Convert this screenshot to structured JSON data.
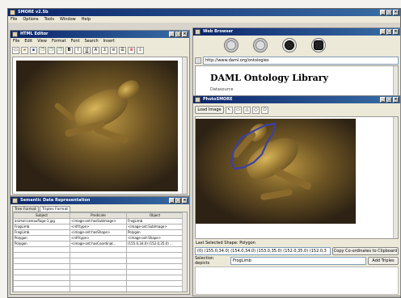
{
  "main_window": {
    "title": "SMORE v2.5b",
    "menu": [
      "File",
      "Options",
      "Tools",
      "Window",
      "Help"
    ]
  },
  "html_editor": {
    "title": "HTML Editor",
    "menu": [
      "File",
      "Edit",
      "View",
      "Format",
      "Font",
      "Search",
      "Insert"
    ],
    "toolbar_icons": [
      "new-icon",
      "open-icon",
      "save-icon",
      "copy-icon",
      "paste-icon",
      "find-icon",
      "bold-icon",
      "italic-icon",
      "underline-icon",
      "link-icon",
      "anchor-icon",
      "align-left-icon",
      "list-icon",
      "stop-icon",
      "download-icon"
    ]
  },
  "semantic_data": {
    "title": "Semantic Data Representation",
    "tabs": [
      "Tree Format",
      "Triples Format"
    ],
    "columns": [
      "Subject",
      "Predicate",
      "Object"
    ],
    "rows": [
      [
        "animal:camouflage-1.jpg",
        "<image-ont:hasSubImage>",
        "FrogLimb"
      ],
      [
        "FrogLimb",
        "<rdf:type>",
        "<image-ont:SubImage>"
      ],
      [
        "FrogLimb",
        "<image-ont:hasShape>",
        "Polygon"
      ],
      [
        "Polygon",
        "<rdf:type>",
        "<image-ont:Shape>"
      ],
      [
        "Polygon",
        "<image-ont:hasCoordinat...",
        "(155.0,34.0) (152.0,35.0) ..."
      ]
    ]
  },
  "web_browser": {
    "title": "Web Browser",
    "url": "http://www.daml.org/ontologies",
    "page_heading": "DAML Ontology Library",
    "page_text": "Datasource"
  },
  "photo_smore": {
    "title": "PhotoSMORE",
    "load_image_label": "Load Image",
    "shape_tools": [
      "pointer-icon",
      "rectangle-icon",
      "triangle-icon",
      "circle-icon",
      "polygon-icon"
    ],
    "last_selected_shape": "Last Selected Shape: Polygon",
    "coordinates": "(0) (155.0,34.0) (154.0,34.0) (153.0,35.0) (152.0,35.0) (152.0,3",
    "copy_button": "Copy Co-ordinates to Clipboard",
    "selection_label": "Selection depicts",
    "selection_value": "FrogLimb",
    "add_triples_button": "Add Triples"
  },
  "colors": {
    "titlebar_start": "#0a246a",
    "titlebar_end": "#3a6ea5",
    "selection_outline": "#3b3fa8",
    "window_bg": "#ece9d8"
  }
}
